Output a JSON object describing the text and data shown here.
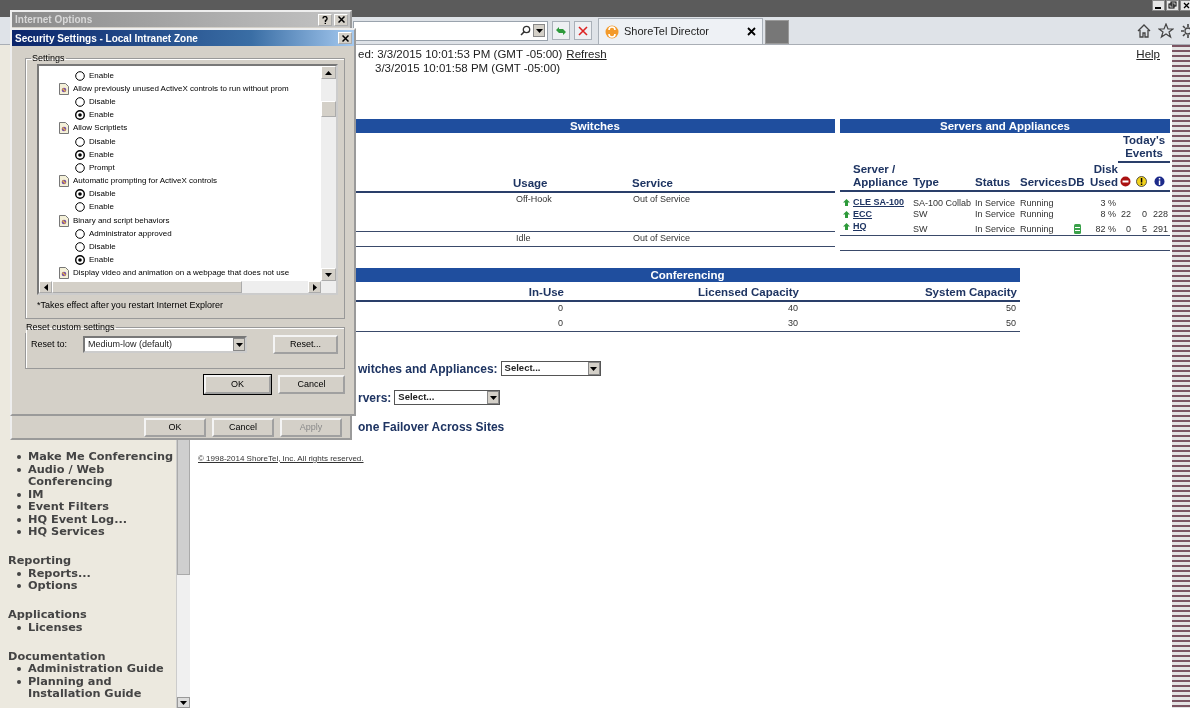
{
  "browser": {
    "tab_title": "ShoreTel Director"
  },
  "page": {
    "last_updated": "ed: 3/3/2015 10:01:53 PM (GMT -05:00)",
    "refresh_link": "Refresh",
    "current_time": "3/3/2015 10:01:58 PM (GMT -05:00)",
    "help_link": "Help",
    "switches": {
      "title": "Switches",
      "columns": [
        "Usage",
        "Service"
      ],
      "rows": [
        [
          "Off-Hook",
          "Out of Service"
        ],
        [
          "Idle",
          "Out of Service"
        ]
      ]
    },
    "servers": {
      "title": "Servers and Appliances",
      "events_heading": "Today's Events",
      "columns": [
        "Server / Appliance",
        "Type",
        "Status",
        "Services",
        "DB",
        "Disk Used"
      ],
      "event_columns": [
        {
          "kind": "critical"
        },
        {
          "kind": "warning"
        },
        {
          "kind": "info"
        }
      ],
      "rows": [
        {
          "name": "CLE SA-100",
          "type": "SA-100 Collab",
          "status": "In Service",
          "services": "Running",
          "db": false,
          "disk_used": "3 %",
          "events": []
        },
        {
          "name": "ECC",
          "type": "SW",
          "status": "In Service",
          "services": "Running",
          "db": false,
          "disk_used": "8 %",
          "events": [
            "22",
            "0",
            "228"
          ]
        },
        {
          "name": "HQ",
          "type": "SW",
          "status": "In Service",
          "services": "Running",
          "db": true,
          "disk_used": "82 %",
          "events": [
            "0",
            "5",
            "291"
          ]
        }
      ]
    },
    "conferencing": {
      "title": "Conferencing",
      "columns": [
        "In-Use",
        "Licensed Capacity",
        "System Capacity"
      ],
      "rows": [
        [
          "0",
          "40",
          "50"
        ],
        [
          "0",
          "30",
          "50"
        ]
      ]
    },
    "selectors": [
      {
        "label": "witches and Appliances:",
        "value": "Select..."
      },
      {
        "label": "rvers:",
        "value": "Select..."
      }
    ],
    "failover_heading": "one Failover Across Sites",
    "copyright": "© 1998-2014 ShoreTel, Inc. All rights reserved."
  },
  "sidebar": {
    "sections": [
      {
        "items": [
          "Make Me Conferencing",
          "Audio / Web Conferencing",
          "IM",
          "Event Filters",
          "HQ Event Log...",
          "HQ Services"
        ]
      },
      {
        "title": "Reporting",
        "items": [
          "Reports...",
          "Options"
        ]
      },
      {
        "title": "Applications",
        "items": [
          "Licenses"
        ]
      },
      {
        "title": "Documentation",
        "items": [
          "Administration Guide",
          "Planning and Installation Guide"
        ]
      }
    ]
  },
  "dialogs": {
    "internet_options": {
      "title": "Internet Options",
      "buttons": [
        {
          "label": "OK",
          "disabled": false
        },
        {
          "label": "Cancel",
          "disabled": false
        },
        {
          "label": "Apply",
          "disabled": true
        }
      ]
    },
    "security_settings": {
      "title": "Security Settings - Local Intranet Zone",
      "settings_group": "Settings",
      "settings": [
        {
          "kind": "option",
          "label": "Enable",
          "selected": false
        },
        {
          "kind": "heading",
          "label": "Allow previously unused ActiveX controls to run without prom"
        },
        {
          "kind": "option",
          "label": "Disable",
          "selected": false
        },
        {
          "kind": "option",
          "label": "Enable",
          "selected": true
        },
        {
          "kind": "heading",
          "label": "Allow Scriptlets"
        },
        {
          "kind": "option",
          "label": "Disable",
          "selected": false
        },
        {
          "kind": "option",
          "label": "Enable",
          "selected": true
        },
        {
          "kind": "option",
          "label": "Prompt",
          "selected": false
        },
        {
          "kind": "heading",
          "label": "Automatic prompting for ActiveX controls"
        },
        {
          "kind": "option",
          "label": "Disable",
          "selected": true
        },
        {
          "kind": "option",
          "label": "Enable",
          "selected": false
        },
        {
          "kind": "heading",
          "label": "Binary and script behaviors"
        },
        {
          "kind": "option",
          "label": "Administrator approved",
          "selected": false
        },
        {
          "kind": "option",
          "label": "Disable",
          "selected": false
        },
        {
          "kind": "option",
          "label": "Enable",
          "selected": true
        },
        {
          "kind": "heading",
          "label": "Display video and animation on a webpage that does not use"
        }
      ],
      "note": "*Takes effect after you restart Internet Explorer",
      "reset_group": "Reset custom settings",
      "reset_label": "Reset to:",
      "reset_value": "Medium-low (default)",
      "reset_button": "Reset...",
      "buttons": [
        "OK",
        "Cancel"
      ]
    }
  }
}
